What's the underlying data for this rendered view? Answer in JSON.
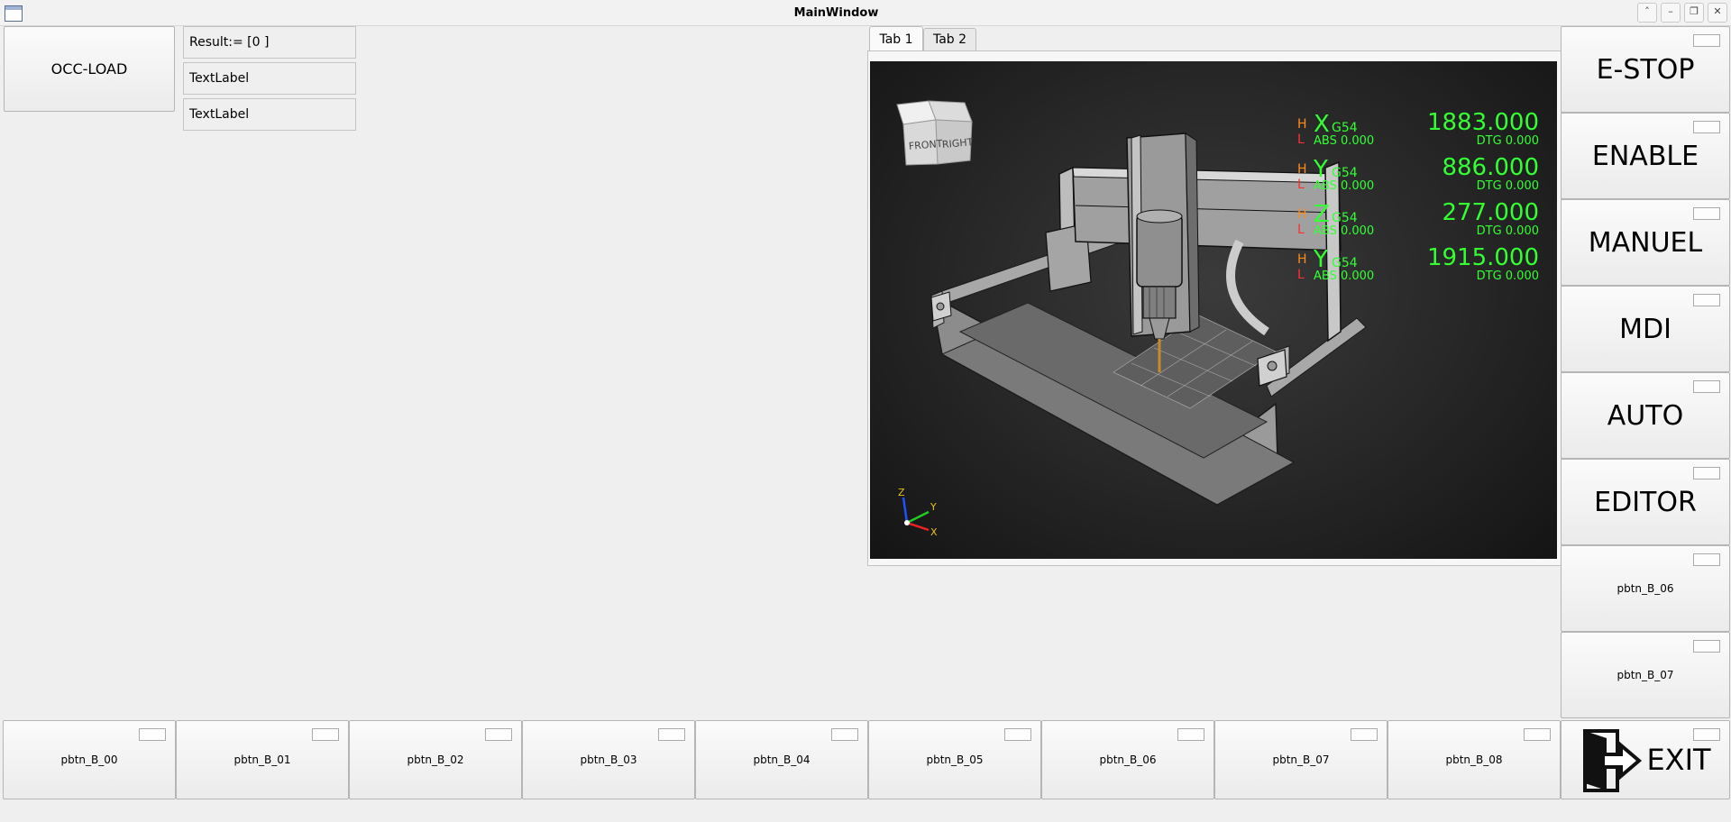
{
  "window": {
    "title": "MainWindow"
  },
  "left_panel": {
    "occ_load_label": "OCC-LOAD",
    "result_label": "Result:= [0 ]",
    "text_label_1": "TextLabel",
    "text_label_2": "TextLabel"
  },
  "tabs": [
    {
      "label": "Tab 1"
    },
    {
      "label": "Tab 2"
    }
  ],
  "viewcube": {
    "front": "FRONT",
    "right": "RIGHT"
  },
  "axes_triad": {
    "x": "X",
    "y": "Y",
    "z": "Z"
  },
  "dro": {
    "rows": [
      {
        "axis": "X",
        "cs": "G54",
        "value": "1883.000",
        "abs": "ABS  0.000",
        "dtg": "DTG 0.000",
        "h": "H",
        "l": "L"
      },
      {
        "axis": "Y",
        "cs": "G54",
        "value": "886.000",
        "abs": "ABS  0.000",
        "dtg": "DTG 0.000",
        "h": "H",
        "l": "L"
      },
      {
        "axis": "Z",
        "cs": "G54",
        "value": "277.000",
        "abs": "ABS  0.000",
        "dtg": "DTG 0.000",
        "h": "H",
        "l": "L"
      },
      {
        "axis": "Y",
        "cs": "G54",
        "value": "1915.000",
        "abs": "ABS  0.000",
        "dtg": "DTG 0.000",
        "h": "H",
        "l": "L"
      }
    ],
    "colors": {
      "value": "#33ff33",
      "h": "#ff8c1a",
      "l": "#ff3030"
    }
  },
  "right_buttons": [
    {
      "label": "E-STOP"
    },
    {
      "label": "ENABLE"
    },
    {
      "label": "MANUEL"
    },
    {
      "label": "MDI"
    },
    {
      "label": "AUTO"
    },
    {
      "label": "EDITOR"
    },
    {
      "label": "pbtn_B_06"
    },
    {
      "label": "pbtn_B_07"
    }
  ],
  "bottom_buttons": [
    {
      "label": "pbtn_B_00"
    },
    {
      "label": "pbtn_B_01"
    },
    {
      "label": "pbtn_B_02"
    },
    {
      "label": "pbtn_B_03"
    },
    {
      "label": "pbtn_B_04"
    },
    {
      "label": "pbtn_B_05"
    },
    {
      "label": "pbtn_B_06"
    },
    {
      "label": "pbtn_B_07"
    },
    {
      "label": "pbtn_B_08"
    }
  ],
  "exit_button": {
    "label": "EXIT",
    "icon": "exit-door-icon"
  }
}
